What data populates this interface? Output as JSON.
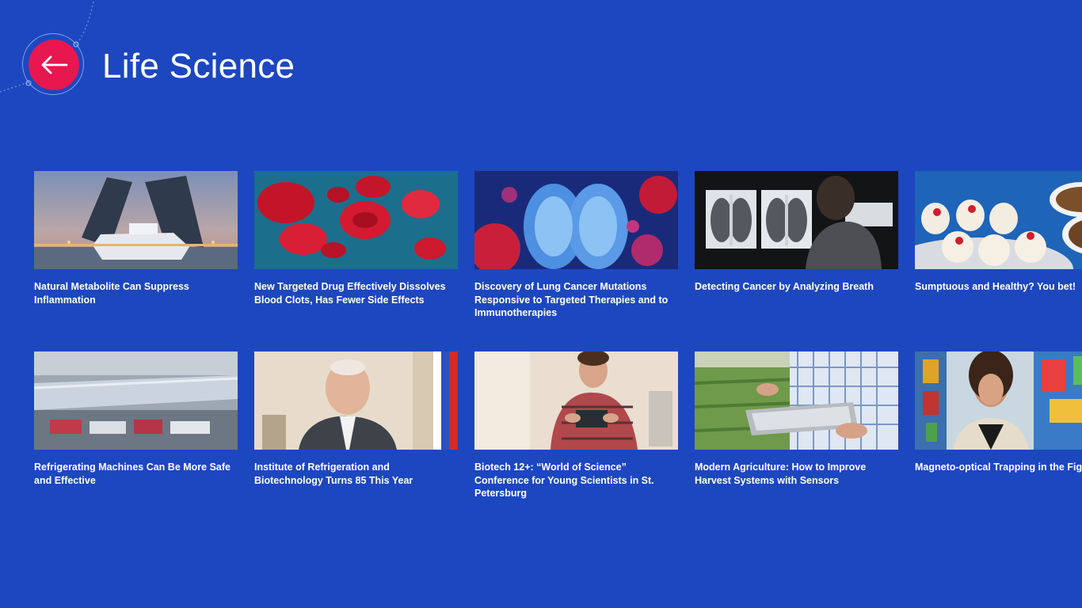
{
  "header": {
    "title": "Life Science",
    "back_icon": "arrow-left-icon",
    "back_color": "#e8174f"
  },
  "theme": {
    "background": "#1d47bf",
    "text": "#ffffff"
  },
  "articles": [
    {
      "title": "Natural Metabolite Can Suppress Inflammation",
      "image": "drawbridge-ship-photo"
    },
    {
      "title": "New Targeted Drug Effectively Dissolves Blood Clots, Has Fewer Side Effects",
      "image": "red-blood-cells-photo"
    },
    {
      "title": "Discovery of Lung Cancer Mutations Responsive to Targeted Therapies and to Immunotherapies",
      "image": "lung-cancer-cells-photo"
    },
    {
      "title": "Detecting Cancer by Analyzing Breath",
      "image": "doctor-xray-photo"
    },
    {
      "title": "Sumptuous and Healthy? You bet!",
      "image": "desserts-table-photo"
    },
    {
      "title": "Refrigerating Machines Can Be More Safe and Effective",
      "image": "supermarket-freezer-photo"
    },
    {
      "title": "Institute of Refrigeration and Biotechnology Turns 85 This Year",
      "image": "elderly-man-office-photo"
    },
    {
      "title": "Biotech 12+: “World of Science” Conference for Young Scientists in St. Petersburg",
      "image": "boy-with-gadget-photo"
    },
    {
      "title": "Modern Agriculture: How to Improve Harvest Systems with Sensors",
      "image": "farmer-tablet-photo"
    },
    {
      "title": "Magneto-optical Trapping in the Fight Against Fatal Diseases",
      "image": "woman-stained-glass-photo"
    }
  ]
}
